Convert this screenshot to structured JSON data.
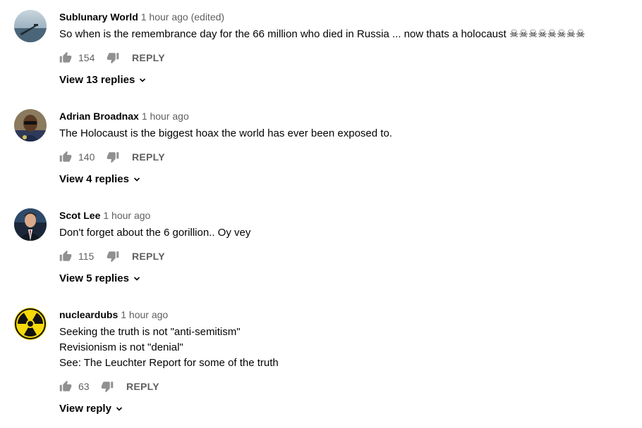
{
  "comments": [
    {
      "author": "Sublunary World",
      "time": "1 hour ago (edited)",
      "lines": [
        "So when is the remembrance day for the 66 million who died in Russia ... now thats a holocaust ☠☠☠☠☠☠☠☠"
      ],
      "likes": "154",
      "reply_label": "REPLY",
      "view_replies": "View 13 replies",
      "avatar": "lake-pier-photo"
    },
    {
      "author": "Adrian Broadnax",
      "time": "1 hour ago",
      "lines": [
        "The Holocaust is the biggest hoax the world has ever been exposed to."
      ],
      "likes": "140",
      "reply_label": "REPLY",
      "view_replies": "View 4 replies",
      "avatar": "man-portrait-photo"
    },
    {
      "author": "Scot Lee",
      "time": "1 hour ago",
      "lines": [
        "Don't forget about the 6 gorillion.. Oy vey"
      ],
      "likes": "115",
      "reply_label": "REPLY",
      "view_replies": "View 5 replies",
      "avatar": "man-suit-photo"
    },
    {
      "author": "nucleardubs",
      "time": "1 hour ago",
      "lines": [
        "Seeking the truth is not \"anti-semitism\"",
        "Revisionism is not \"denial\"",
        "See: The Leuchter Report for some of the truth"
      ],
      "likes": "63",
      "reply_label": "REPLY",
      "view_replies": "View reply",
      "avatar": "radiation-symbol"
    }
  ],
  "colors": {
    "text_primary": "#030303",
    "text_secondary": "#606060",
    "icon": "#909090",
    "radiation_yellow": "#f5d90a"
  }
}
